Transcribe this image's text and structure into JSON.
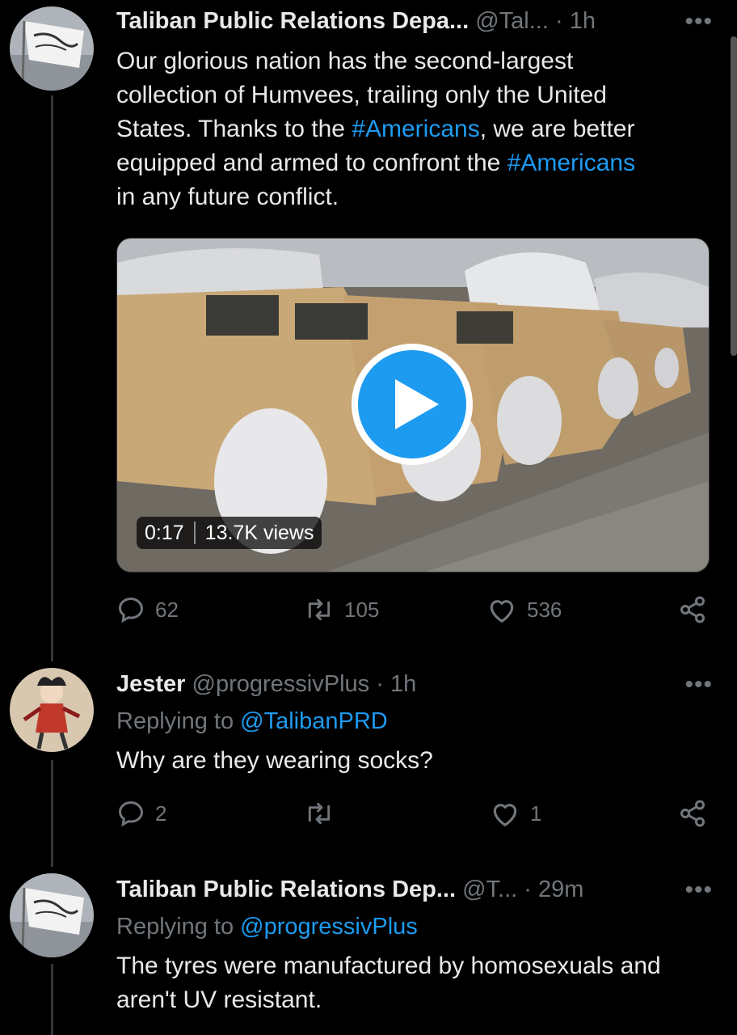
{
  "tweets": [
    {
      "name": "Taliban Public Relations Depa...",
      "handle": "@Tal...",
      "sep": "·",
      "time": "1h",
      "more": "•••",
      "text": {
        "l1": "Our glorious nation has the second-largest",
        "l2": "collection of Humvees, trailing only the United",
        "l3a": "States. Thanks to the ",
        "l3b": "#Americans",
        "l3c": ", we are better",
        "l4a": "equipped and armed to confront the ",
        "l4b": "#Americans",
        "l5": "in any future conflict."
      },
      "video": {
        "duration": "0:17",
        "views": "13.7K views"
      },
      "actions": {
        "replies": "62",
        "retweets": "105",
        "likes": "536"
      }
    },
    {
      "name": "Jester",
      "handle": "@progressivPlus",
      "sep": "·",
      "time": "1h",
      "more": "•••",
      "replying_prefix": "Replying to ",
      "replying_to": "@TalibanPRD",
      "text": "Why are they wearing socks?",
      "actions": {
        "replies": "2",
        "retweets": "",
        "likes": "1"
      }
    },
    {
      "name": "Taliban Public Relations Dep...",
      "handle": "@T...",
      "sep": "·",
      "time": "29m",
      "more": "•••",
      "replying_prefix": "Replying to ",
      "replying_to": "@progressivPlus",
      "text_l1": "The tyres were manufactured by homosexuals and",
      "text_l2": "aren't UV resistant."
    }
  ],
  "icons": {
    "reply": "reply-icon",
    "retweet": "retweet-icon",
    "like": "heart-icon",
    "share": "share-icon",
    "play": "play-icon"
  },
  "colors": {
    "background": "#000000",
    "text": "#e7e9ea",
    "muted": "#71767b",
    "accent": "#1d9bf0"
  }
}
